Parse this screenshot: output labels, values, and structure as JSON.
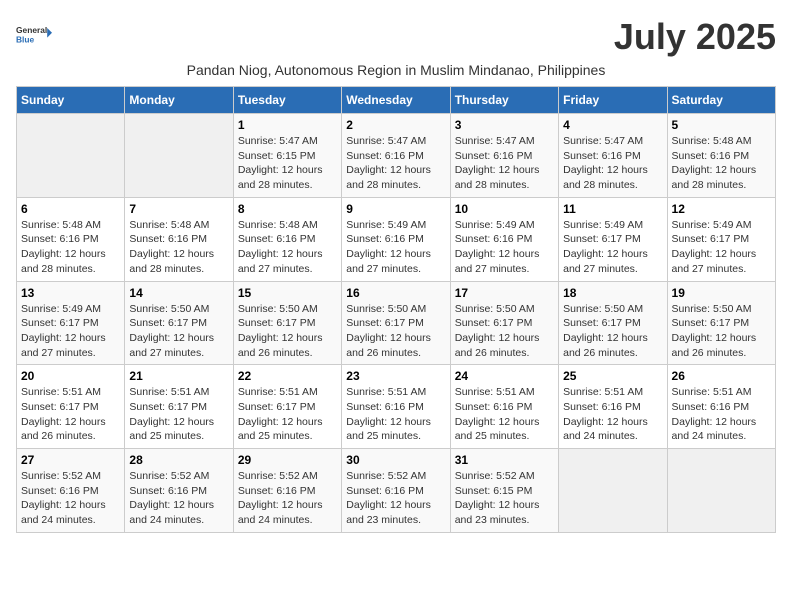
{
  "logo": {
    "line1": "General",
    "line2": "Blue"
  },
  "title": "July 2025",
  "subtitle": "Pandan Niog, Autonomous Region in Muslim Mindanao, Philippines",
  "days_of_week": [
    "Sunday",
    "Monday",
    "Tuesday",
    "Wednesday",
    "Thursday",
    "Friday",
    "Saturday"
  ],
  "weeks": [
    [
      {
        "day": "",
        "info": ""
      },
      {
        "day": "",
        "info": ""
      },
      {
        "day": "1",
        "info": "Sunrise: 5:47 AM\nSunset: 6:15 PM\nDaylight: 12 hours and 28 minutes."
      },
      {
        "day": "2",
        "info": "Sunrise: 5:47 AM\nSunset: 6:16 PM\nDaylight: 12 hours and 28 minutes."
      },
      {
        "day": "3",
        "info": "Sunrise: 5:47 AM\nSunset: 6:16 PM\nDaylight: 12 hours and 28 minutes."
      },
      {
        "day": "4",
        "info": "Sunrise: 5:47 AM\nSunset: 6:16 PM\nDaylight: 12 hours and 28 minutes."
      },
      {
        "day": "5",
        "info": "Sunrise: 5:48 AM\nSunset: 6:16 PM\nDaylight: 12 hours and 28 minutes."
      }
    ],
    [
      {
        "day": "6",
        "info": "Sunrise: 5:48 AM\nSunset: 6:16 PM\nDaylight: 12 hours and 28 minutes."
      },
      {
        "day": "7",
        "info": "Sunrise: 5:48 AM\nSunset: 6:16 PM\nDaylight: 12 hours and 28 minutes."
      },
      {
        "day": "8",
        "info": "Sunrise: 5:48 AM\nSunset: 6:16 PM\nDaylight: 12 hours and 27 minutes."
      },
      {
        "day": "9",
        "info": "Sunrise: 5:49 AM\nSunset: 6:16 PM\nDaylight: 12 hours and 27 minutes."
      },
      {
        "day": "10",
        "info": "Sunrise: 5:49 AM\nSunset: 6:16 PM\nDaylight: 12 hours and 27 minutes."
      },
      {
        "day": "11",
        "info": "Sunrise: 5:49 AM\nSunset: 6:17 PM\nDaylight: 12 hours and 27 minutes."
      },
      {
        "day": "12",
        "info": "Sunrise: 5:49 AM\nSunset: 6:17 PM\nDaylight: 12 hours and 27 minutes."
      }
    ],
    [
      {
        "day": "13",
        "info": "Sunrise: 5:49 AM\nSunset: 6:17 PM\nDaylight: 12 hours and 27 minutes."
      },
      {
        "day": "14",
        "info": "Sunrise: 5:50 AM\nSunset: 6:17 PM\nDaylight: 12 hours and 27 minutes."
      },
      {
        "day": "15",
        "info": "Sunrise: 5:50 AM\nSunset: 6:17 PM\nDaylight: 12 hours and 26 minutes."
      },
      {
        "day": "16",
        "info": "Sunrise: 5:50 AM\nSunset: 6:17 PM\nDaylight: 12 hours and 26 minutes."
      },
      {
        "day": "17",
        "info": "Sunrise: 5:50 AM\nSunset: 6:17 PM\nDaylight: 12 hours and 26 minutes."
      },
      {
        "day": "18",
        "info": "Sunrise: 5:50 AM\nSunset: 6:17 PM\nDaylight: 12 hours and 26 minutes."
      },
      {
        "day": "19",
        "info": "Sunrise: 5:50 AM\nSunset: 6:17 PM\nDaylight: 12 hours and 26 minutes."
      }
    ],
    [
      {
        "day": "20",
        "info": "Sunrise: 5:51 AM\nSunset: 6:17 PM\nDaylight: 12 hours and 26 minutes."
      },
      {
        "day": "21",
        "info": "Sunrise: 5:51 AM\nSunset: 6:17 PM\nDaylight: 12 hours and 25 minutes."
      },
      {
        "day": "22",
        "info": "Sunrise: 5:51 AM\nSunset: 6:17 PM\nDaylight: 12 hours and 25 minutes."
      },
      {
        "day": "23",
        "info": "Sunrise: 5:51 AM\nSunset: 6:16 PM\nDaylight: 12 hours and 25 minutes."
      },
      {
        "day": "24",
        "info": "Sunrise: 5:51 AM\nSunset: 6:16 PM\nDaylight: 12 hours and 25 minutes."
      },
      {
        "day": "25",
        "info": "Sunrise: 5:51 AM\nSunset: 6:16 PM\nDaylight: 12 hours and 24 minutes."
      },
      {
        "day": "26",
        "info": "Sunrise: 5:51 AM\nSunset: 6:16 PM\nDaylight: 12 hours and 24 minutes."
      }
    ],
    [
      {
        "day": "27",
        "info": "Sunrise: 5:52 AM\nSunset: 6:16 PM\nDaylight: 12 hours and 24 minutes."
      },
      {
        "day": "28",
        "info": "Sunrise: 5:52 AM\nSunset: 6:16 PM\nDaylight: 12 hours and 24 minutes."
      },
      {
        "day": "29",
        "info": "Sunrise: 5:52 AM\nSunset: 6:16 PM\nDaylight: 12 hours and 24 minutes."
      },
      {
        "day": "30",
        "info": "Sunrise: 5:52 AM\nSunset: 6:16 PM\nDaylight: 12 hours and 23 minutes."
      },
      {
        "day": "31",
        "info": "Sunrise: 5:52 AM\nSunset: 6:15 PM\nDaylight: 12 hours and 23 minutes."
      },
      {
        "day": "",
        "info": ""
      },
      {
        "day": "",
        "info": ""
      }
    ]
  ]
}
